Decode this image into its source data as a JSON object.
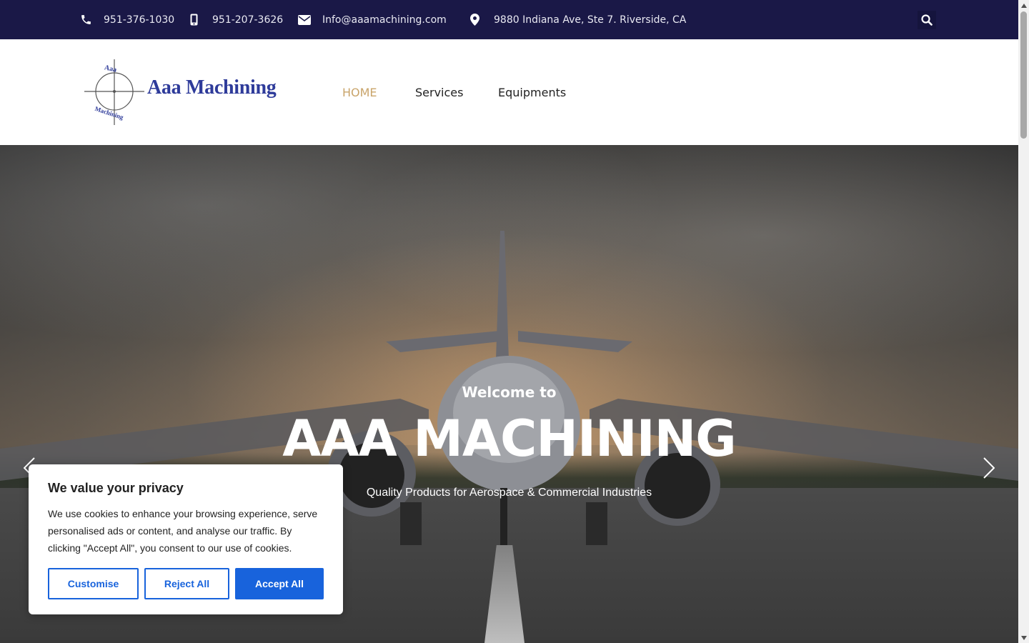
{
  "topbar": {
    "phone1": "951-376-1030",
    "phone2": "951-207-3626",
    "email": "Info@aaamachining.com",
    "address": "9880 Indiana Ave, Ste 7. Riverside, CA",
    "icons": [
      "phone-icon",
      "mobile-icon",
      "envelope-icon",
      "map-marker-icon",
      "search-icon"
    ]
  },
  "header": {
    "logo_text": "Aaa Machining",
    "logo_ring_top": "Aaa",
    "logo_ring_bottom": "Machining",
    "nav": [
      {
        "label": "HOME",
        "active": true
      },
      {
        "label": "Services"
      },
      {
        "label": "Equipments"
      }
    ]
  },
  "hero": {
    "subtitle": "Welcome to",
    "title": "AAA MACHINING",
    "tagline": "Quality Products for Aerospace & Commercial Industries"
  },
  "cookie": {
    "title": "We value your privacy",
    "body": "We use cookies to enhance your browsing experience, serve personalised ads or content, and analyse our traffic. By clicking \"Accept All\", you consent to our use of cookies.",
    "customise": "Customise",
    "reject": "Reject All",
    "accept": "Accept All"
  },
  "colors": {
    "topbar_bg": "#1a1847",
    "brand_blue": "#2e3b9a",
    "nav_active": "#c9a46a",
    "cookie_accent": "#1863dc"
  }
}
